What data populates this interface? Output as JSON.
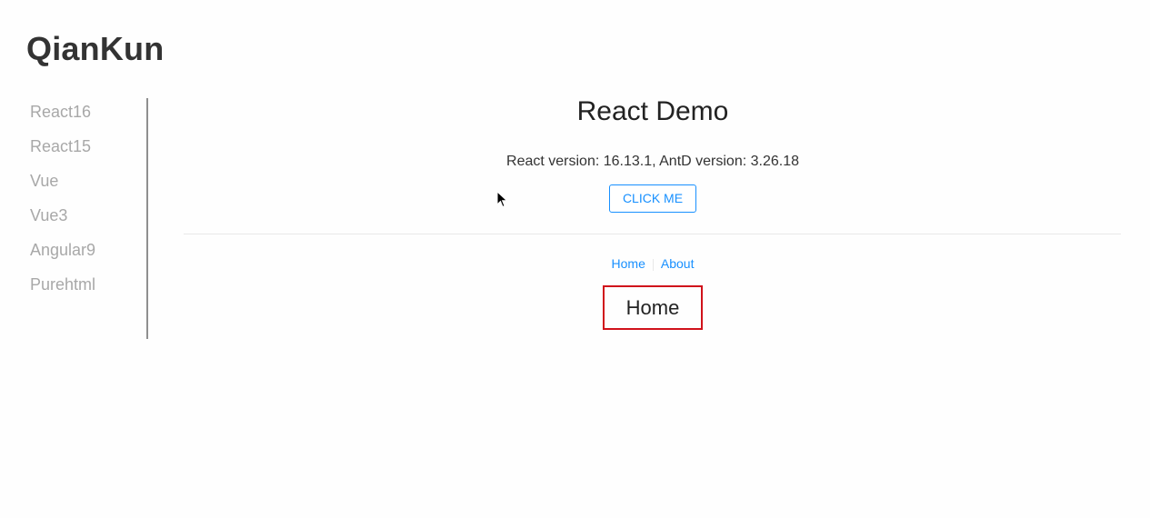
{
  "app": {
    "title": "QianKun"
  },
  "sidebar": {
    "items": [
      {
        "label": "React16"
      },
      {
        "label": "React15"
      },
      {
        "label": "Vue"
      },
      {
        "label": "Vue3"
      },
      {
        "label": "Angular9"
      },
      {
        "label": "Purehtml"
      }
    ]
  },
  "main": {
    "title": "React Demo",
    "version_text": "React version: 16.13.1, AntD version: 3.26.18",
    "click_button_label": "CLICK ME",
    "nav": {
      "home_label": "Home",
      "about_label": "About"
    },
    "route_content": "Home"
  },
  "colors": {
    "accent": "#1890ff",
    "highlight_border": "#d0121b",
    "sidebar_text": "#a8a8a8"
  },
  "icons": {
    "cursor": "mouse-pointer-icon"
  }
}
